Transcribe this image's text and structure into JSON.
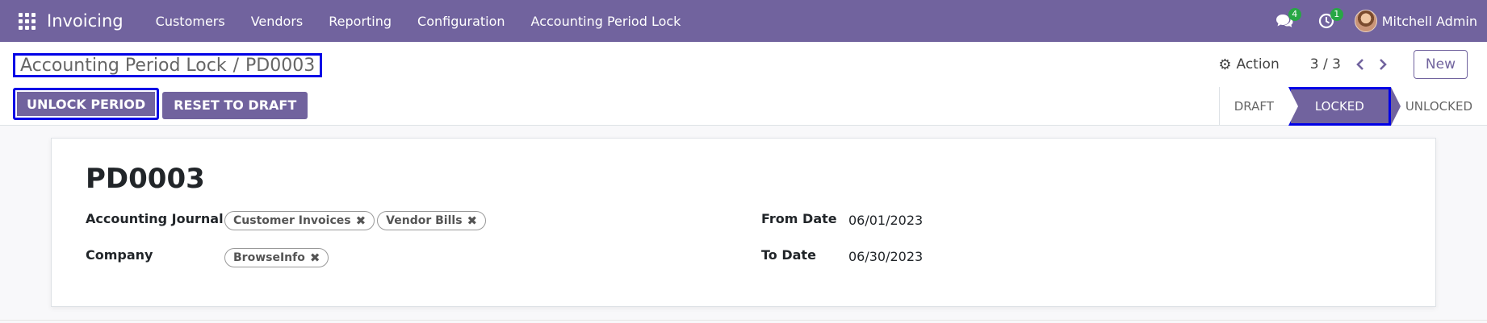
{
  "navbar": {
    "brand": "Invoicing",
    "menu": [
      "Customers",
      "Vendors",
      "Reporting",
      "Configuration",
      "Accounting Period Lock"
    ],
    "messages_count": "4",
    "activities_count": "1",
    "user_name": "Mitchell Admin",
    "icons": {
      "apps": "apps-grid-icon",
      "messages": "chat-icon",
      "activities": "clock-icon"
    }
  },
  "breadcrumb": {
    "parent": "Accounting Period Lock",
    "separator": "/",
    "current": "PD0003"
  },
  "control": {
    "action_label": "Action",
    "pager": "3 / 3",
    "new_label": "New"
  },
  "buttons": {
    "unlock": "UNLOCK PERIOD",
    "reset": "RESET TO DRAFT"
  },
  "statusbar": {
    "items": [
      "DRAFT",
      "LOCKED",
      "UNLOCKED"
    ],
    "active": "LOCKED"
  },
  "form": {
    "title": "PD0003",
    "journal_label": "Accounting Journal",
    "journals": [
      "Customer Invoices",
      "Vendor Bills"
    ],
    "company_label": "Company",
    "companies": [
      "BrowseInfo"
    ],
    "from_label": "From Date",
    "from_value": "06/01/2023",
    "to_label": "To Date",
    "to_value": "06/30/2023"
  },
  "colors": {
    "brand": "#71639e",
    "highlight": "#0000e6",
    "badge": "#28a745"
  }
}
